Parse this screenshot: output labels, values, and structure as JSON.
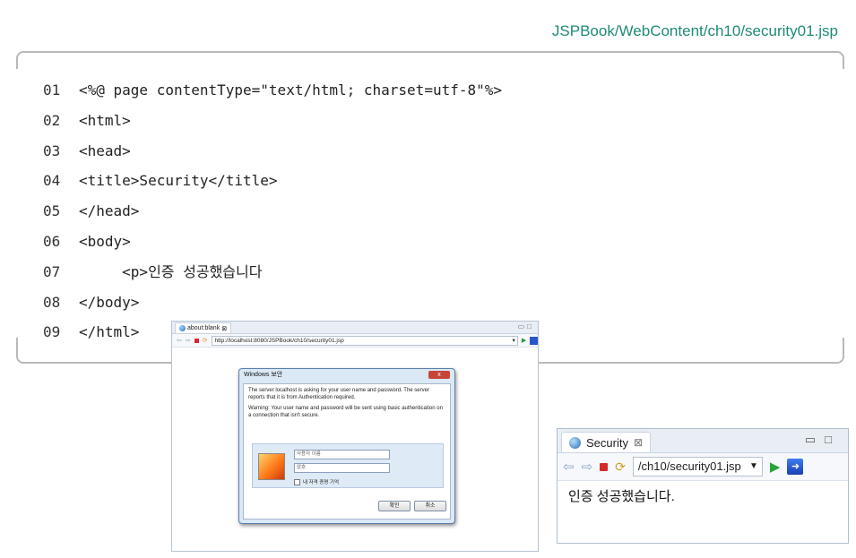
{
  "file_path": "JSPBook/WebContent/ch10/security01.jsp",
  "code_lines": [
    {
      "num": "01",
      "text": "<%@ page contentType=\"text/html; charset=utf-8\"%>"
    },
    {
      "num": "02",
      "text": "<html>"
    },
    {
      "num": "03",
      "text": "<head>"
    },
    {
      "num": "04",
      "text": "<title>Security</title>"
    },
    {
      "num": "05",
      "text": "</head>"
    },
    {
      "num": "06",
      "text": "<body>"
    },
    {
      "num": "07",
      "text": "     <p>인증 성공했습니다"
    },
    {
      "num": "08",
      "text": "</body>"
    },
    {
      "num": "09",
      "text": "</html>"
    }
  ],
  "browser1": {
    "tab_title": "about:blank",
    "url": "http://localhost:8080/JSPBook/ch10/security01.jsp",
    "dialog": {
      "title": "Windows 보안",
      "close_label": "x",
      "message": "The server localhost is asking for your user name and password. The server reports that it is from Authentication required.",
      "warning": "Warning: Your user name and password will be sent using basic authentication on a connection that isn't secure.",
      "username_placeholder": "사용자 이름",
      "password_placeholder": "암호",
      "remember_label": "내 자격 증명 기억",
      "ok_label": "확인",
      "cancel_label": "취소"
    }
  },
  "browser2": {
    "tab_title": "Security",
    "url": "/ch10/security01.jsp",
    "content": "인증 성공했습니다."
  },
  "icons": {
    "tab_close": "close-icon",
    "back": "back-arrow-icon",
    "forward": "forward-arrow-icon",
    "stop": "stop-icon",
    "refresh": "refresh-icon",
    "go": "go-icon"
  },
  "colors": {
    "file_path": "#1f8a78",
    "frame_border": "#b9b9b9"
  }
}
